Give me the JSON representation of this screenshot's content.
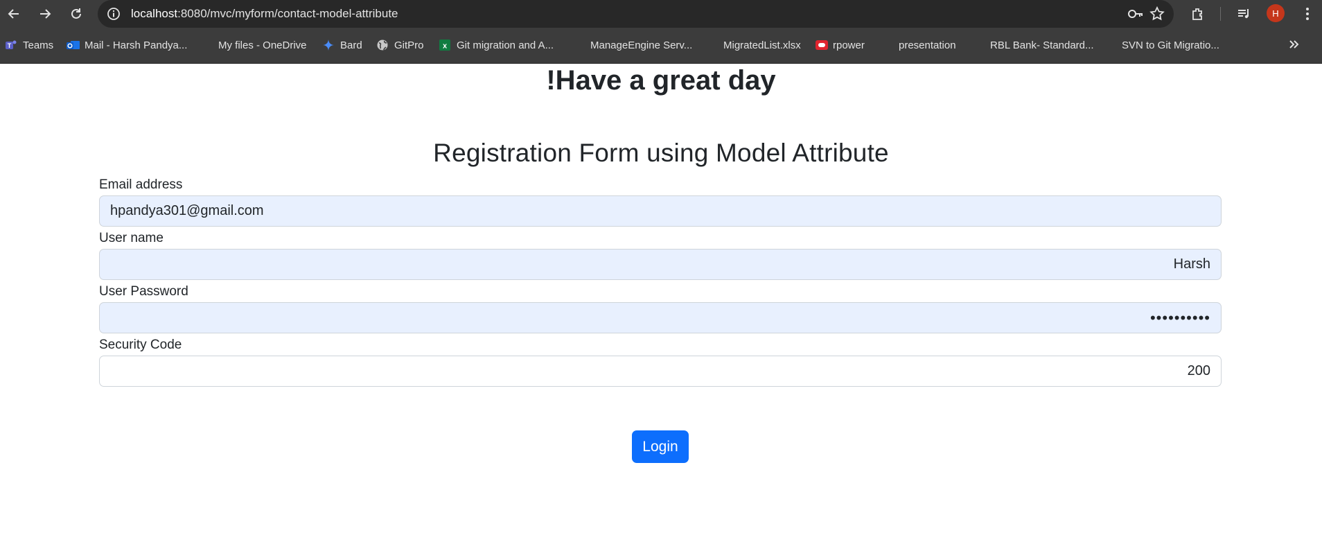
{
  "browser": {
    "url_domain": "localhost",
    "url_path": ":8080/mvc/myform/contact-model-attribute",
    "avatar_initial": "H",
    "bookmarks": [
      {
        "label": "Teams",
        "icon": "teams-icon"
      },
      {
        "label": "Mail - Harsh Pandya...",
        "icon": "outlook-icon"
      },
      {
        "label": "My files - OneDrive",
        "icon": "microsoft-icon"
      },
      {
        "label": "Bard",
        "icon": "bard-sparkle-icon"
      },
      {
        "label": "GitPro",
        "icon": "globe-icon"
      },
      {
        "label": "Git migration and A...",
        "icon": "excel-icon"
      },
      {
        "label": "ManageEngine Serv...",
        "icon": "microsoft-icon"
      },
      {
        "label": "MigratedList.xlsx",
        "icon": "microsoft-icon"
      },
      {
        "label": "rpower",
        "icon": "oracle-icon"
      },
      {
        "label": "presentation",
        "icon": "microsoft-icon"
      },
      {
        "label": "RBL Bank- Standard...",
        "icon": "microsoft-icon"
      },
      {
        "label": "SVN to Git Migratio...",
        "icon": "microsoft-icon"
      }
    ]
  },
  "page": {
    "greeting": "!Have a great day",
    "form_title": "Registration Form using Model Attribute",
    "email_label": "Email address",
    "email_value": "hpandya301@gmail.com",
    "username_label": "User name",
    "username_value": "Harsh",
    "password_label": "User Password",
    "password_value": "••••••••••",
    "security_label": "Security Code",
    "security_value": "200",
    "login_label": "Login"
  },
  "colors": {
    "primary": "#0d6efd",
    "autofill_bg": "#e8f0fe",
    "chrome_bg": "#3c3c3c"
  }
}
